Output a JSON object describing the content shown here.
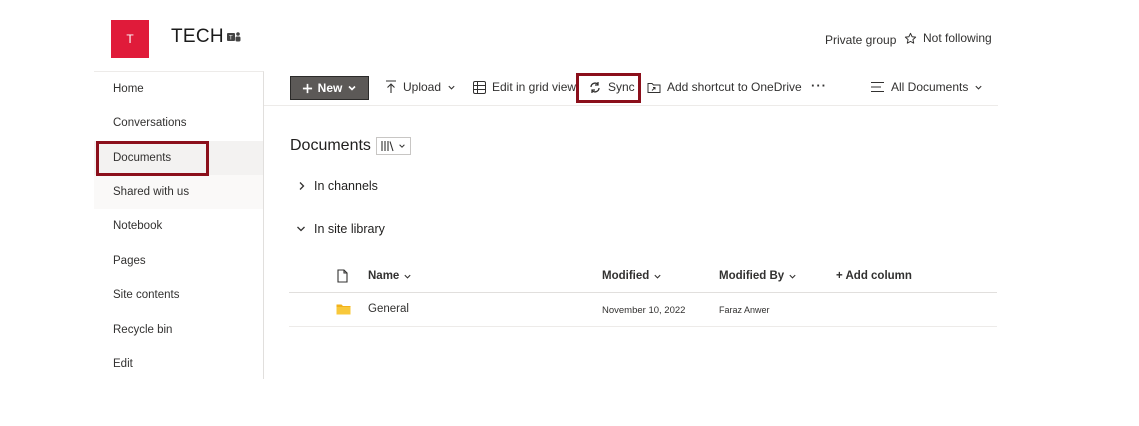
{
  "site": {
    "logo_letter": "T",
    "title": "TECH",
    "privacy": "Private group",
    "follow_label": "Not following",
    "colors": {
      "logo": "#e01b3a",
      "highlight_box": "#8b0f1b",
      "new_button": "#5c5957",
      "folder": "#f2b21b"
    }
  },
  "nav": {
    "items": [
      {
        "label": "Home"
      },
      {
        "label": "Conversations"
      },
      {
        "label": "Documents",
        "selected": true
      },
      {
        "label": "Shared with us"
      },
      {
        "label": "Notebook"
      },
      {
        "label": "Pages"
      },
      {
        "label": "Site contents"
      },
      {
        "label": "Recycle bin"
      },
      {
        "label": "Edit"
      }
    ]
  },
  "toolbar": {
    "new_label": "New",
    "upload_label": "Upload",
    "grid_label": "Edit in grid view",
    "sync_label": "Sync",
    "shortcut_label": "Add shortcut to OneDrive",
    "more_label": "···",
    "view_label": "All Documents"
  },
  "library": {
    "title": "Documents",
    "sections": [
      {
        "label": "In channels",
        "expanded": false
      },
      {
        "label": "In site library",
        "expanded": true
      }
    ],
    "columns": {
      "name": "Name",
      "modified": "Modified",
      "modified_by": "Modified By",
      "add_column": "+ Add column"
    },
    "rows": [
      {
        "icon": "folder-icon",
        "name": "General",
        "modified": "November 10, 2022",
        "modified_by": "Faraz Anwer"
      }
    ]
  },
  "icons": [
    "teams-icon",
    "star-icon",
    "plus-icon",
    "upload-icon",
    "grid-icon",
    "sync-icon",
    "shortcut-icon",
    "view-list-icon",
    "library-view-icon",
    "file-type-icon",
    "folder-icon",
    "chevron-down-icon",
    "chevron-right-icon"
  ]
}
